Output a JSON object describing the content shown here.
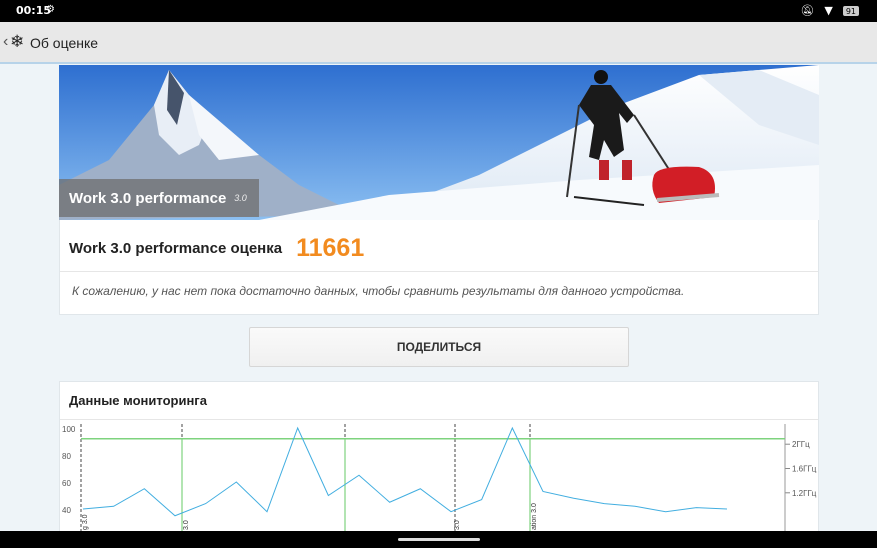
{
  "status_bar": {
    "time": "00:15",
    "battery": "91"
  },
  "app_bar": {
    "title": "Об оценке"
  },
  "hero": {
    "test_name": "Work 3.0 performance",
    "version": "3.0"
  },
  "score": {
    "label": "Work 3.0 performance оценка",
    "value": "11661"
  },
  "note": "К сожалению, у нас нет пока достаточно данных, чтобы сравнить результаты для данного устройства.",
  "share_label": "ПОДЕЛИТЬСЯ",
  "monitoring": {
    "title": "Данные мониторинга",
    "colors": {
      "freq": "#7ed37e",
      "load": "#42aee0",
      "marker": "#444444"
    },
    "chart_data": {
      "type": "line",
      "title": "",
      "y_left_ticks": [
        "100",
        "80",
        "60",
        "40"
      ],
      "y_right_ticks": [
        "2ГГц",
        "1.6ГГц",
        "1.2ГГц"
      ],
      "segment_labels": [
        "g 3.0",
        "3.0",
        "3.0",
        "ation 3.0"
      ],
      "series": [
        {
          "values": [
            92,
            92,
            92,
            92,
            92,
            92,
            92,
            92,
            92,
            92,
            92,
            92
          ]
        },
        {
          "values": [
            40,
            42,
            55,
            35,
            44,
            60,
            38,
            100,
            50,
            65,
            45,
            55,
            38,
            47,
            100,
            53,
            48,
            44,
            42,
            38,
            41,
            40
          ]
        }
      ]
    }
  }
}
